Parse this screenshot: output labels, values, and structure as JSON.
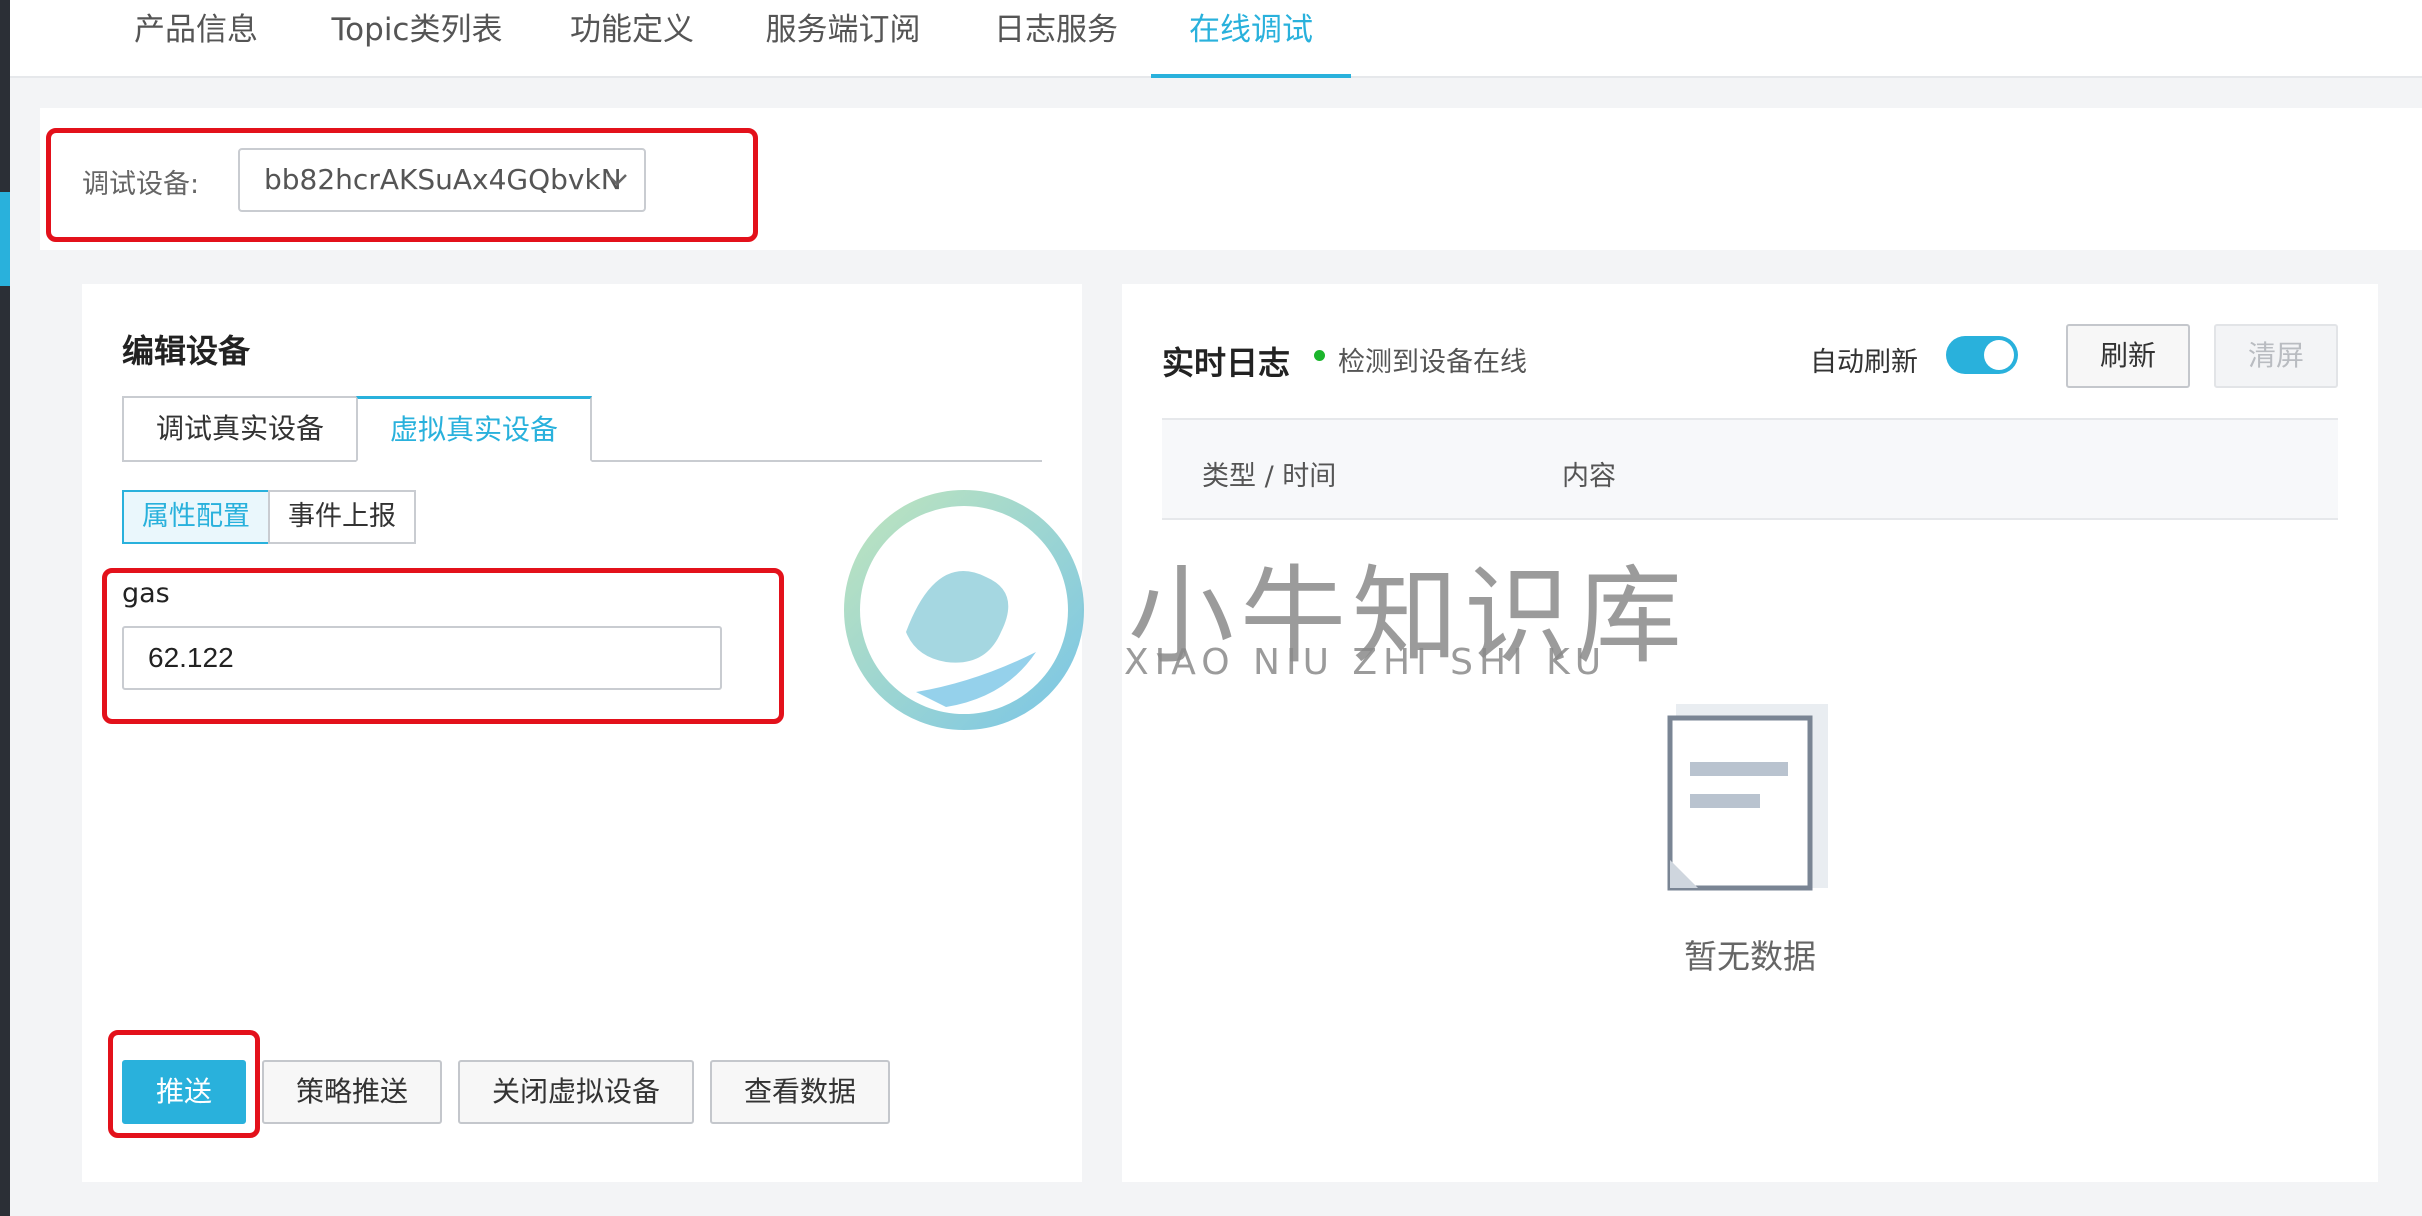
{
  "top_tabs": [
    {
      "label": "产品信息"
    },
    {
      "label": "Topic类列表"
    },
    {
      "label": "功能定义"
    },
    {
      "label": "服务端订阅"
    },
    {
      "label": "日志服务"
    },
    {
      "label": "在线调试",
      "active": true
    }
  ],
  "device_selector": {
    "label": "调试设备:",
    "value": "bb82hcrAKSuAx4GQbvkN",
    "icon": "chevron-down-icon"
  },
  "edit_panel": {
    "title": "编辑设备",
    "tabs": [
      {
        "label": "调试真实设备"
      },
      {
        "label": "虚拟真实设备",
        "active": true
      }
    ],
    "segments": [
      {
        "label": "属性配置",
        "active": true
      },
      {
        "label": "事件上报"
      }
    ],
    "property": {
      "name": "gas",
      "value": "62.122"
    },
    "buttons": {
      "push": "推送",
      "strategy_push": "策略推送",
      "close_virtual": "关闭虚拟设备",
      "view_data": "查看数据"
    }
  },
  "log_panel": {
    "title": "实时日志",
    "status": "检测到设备在线",
    "auto_refresh_label": "自动刷新",
    "auto_refresh_on": true,
    "refresh_button": "刷新",
    "clear_button": "清屏",
    "columns": {
      "type_time": "类型 / 时间",
      "content": "内容"
    },
    "empty_text": "暂无数据"
  },
  "watermark": {
    "cn": "小牛知识库",
    "en": "XIAO NIU ZHI SHI KU"
  },
  "colors": {
    "accent": "#29b1dc",
    "highlight_box": "#e3111b",
    "online": "#1bb52c"
  }
}
